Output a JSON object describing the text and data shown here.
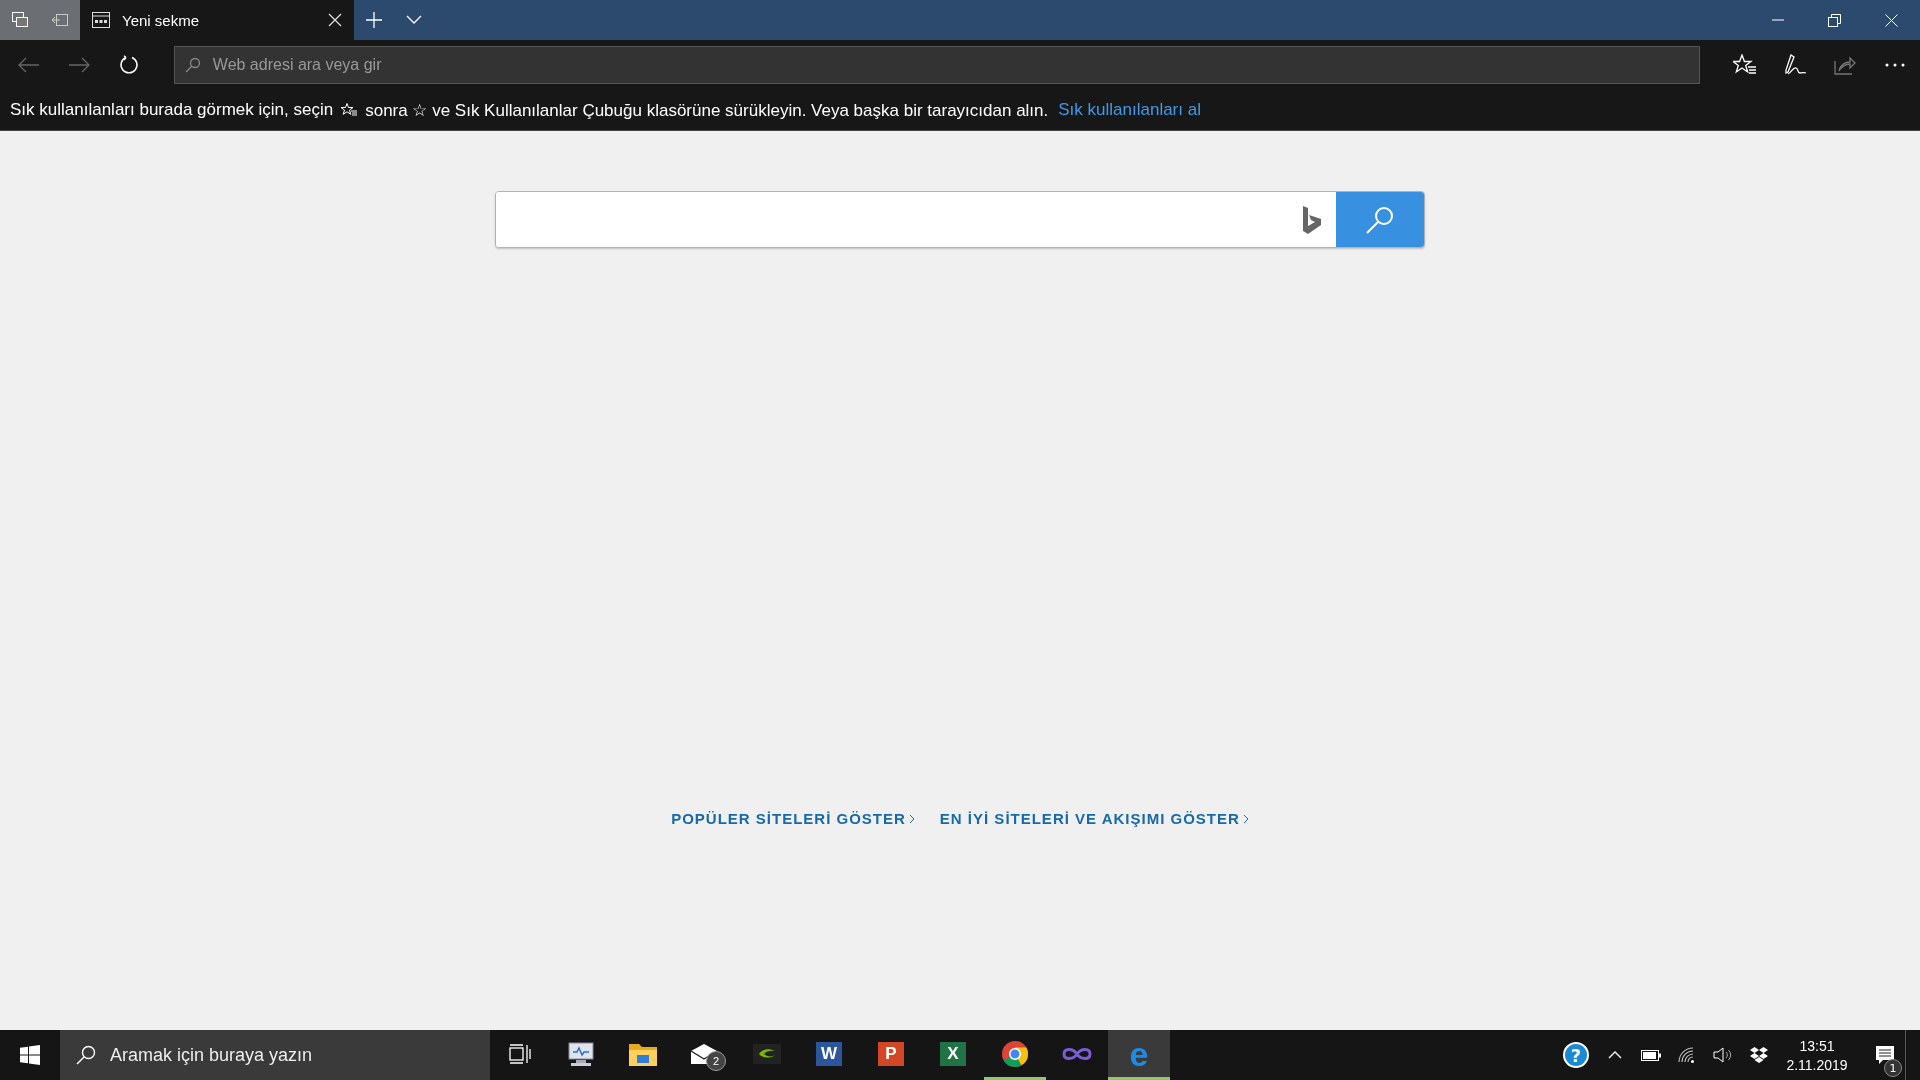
{
  "tab": {
    "title": "Yeni sekme",
    "selected": true
  },
  "address_bar": {
    "placeholder": "Web adresi ara veya gir"
  },
  "favorites_bar": {
    "text_before": "Sık kullanılanları burada görmek için, seçin",
    "text_after": "sonra ☆ ve Sık Kullanılanlar Çubuğu klasörüne sürükleyin. Veya başka bir tarayıcıdan alın.",
    "link": "Sık kullanılanları al"
  },
  "links": [
    "POPÜLER SİTELERİ GÖSTER",
    "EN İYİ SİTELERİ VE AKIŞIMI GÖSTER"
  ],
  "taskbar": {
    "search_placeholder": "Aramak için buraya yazın",
    "apps": [
      {
        "kind": "remote",
        "running": false,
        "selected": false
      },
      {
        "kind": "folder",
        "running": false,
        "selected": false
      },
      {
        "kind": "mail",
        "running": false,
        "selected": false,
        "badge": "2"
      },
      {
        "kind": "nvidia",
        "running": false,
        "selected": false
      },
      {
        "kind": "word",
        "running": false,
        "selected": false,
        "letter": "W"
      },
      {
        "kind": "powerpoint",
        "running": false,
        "selected": false,
        "letter": "P"
      },
      {
        "kind": "excel",
        "running": false,
        "selected": false,
        "letter": "X"
      },
      {
        "kind": "chrome",
        "running": true,
        "selected": false
      },
      {
        "kind": "infinity",
        "running": false,
        "selected": false
      },
      {
        "kind": "edge",
        "running": true,
        "selected": true,
        "letter": "e"
      }
    ],
    "help_glyph": "?",
    "time": "13:51",
    "date": "2.11.2019",
    "notification_count": "1"
  }
}
